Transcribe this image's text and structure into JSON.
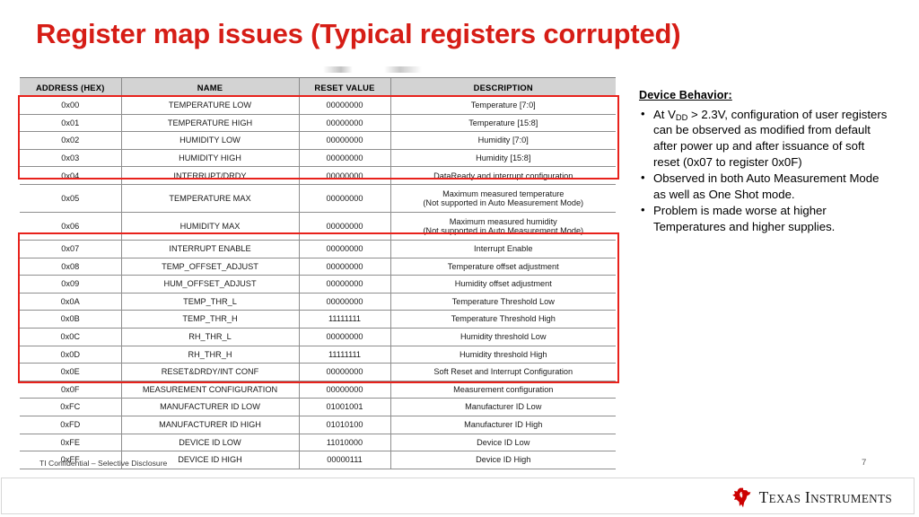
{
  "slide": {
    "title": "Register map issues (Typical registers corrupted)",
    "page_number": "7",
    "confidential": "TI Confidential – Selective Disclosure",
    "accent_red": "#e8221c",
    "title_red": "#d61d16",
    "header_gray": "#d3d3d3"
  },
  "table": {
    "columns": [
      "ADDRESS (HEX)",
      "NAME",
      "RESET VALUE",
      "DESCRIPTION"
    ],
    "rows": [
      {
        "address": "0x00",
        "name": "TEMPERATURE LOW",
        "reset": "00000000",
        "desc": "Temperature [7:0]",
        "desc2": ""
      },
      {
        "address": "0x01",
        "name": "TEMPERATURE HIGH",
        "reset": "00000000",
        "desc": "Temperature [15:8]",
        "desc2": ""
      },
      {
        "address": "0x02",
        "name": "HUMIDITY LOW",
        "reset": "00000000",
        "desc": "Humidity [7:0]",
        "desc2": ""
      },
      {
        "address": "0x03",
        "name": "HUMIDITY HIGH",
        "reset": "00000000",
        "desc": "Humidity [15:8]",
        "desc2": ""
      },
      {
        "address": "0x04",
        "name": "INTERRUPT/DRDY",
        "reset": "00000000",
        "desc": "DataReady and interrupt configuration",
        "desc2": ""
      },
      {
        "address": "0x05",
        "name": "TEMPERATURE MAX",
        "reset": "00000000",
        "desc": "Maximum measured temperature",
        "desc2": "(Not supported in Auto Measurement Mode)"
      },
      {
        "address": "0x06",
        "name": "HUMIDITY MAX",
        "reset": "00000000",
        "desc": "Maximum measured humidity",
        "desc2": "(Not supported in Auto Measurement Mode)"
      },
      {
        "address": "0x07",
        "name": "INTERRUPT ENABLE",
        "reset": "00000000",
        "desc": "Interrupt Enable",
        "desc2": ""
      },
      {
        "address": "0x08",
        "name": "TEMP_OFFSET_ADJUST",
        "reset": "00000000",
        "desc": "Temperature offset adjustment",
        "desc2": ""
      },
      {
        "address": "0x09",
        "name": "HUM_OFFSET_ADJUST",
        "reset": "00000000",
        "desc": "Humidity offset adjustment",
        "desc2": ""
      },
      {
        "address": "0x0A",
        "name": "TEMP_THR_L",
        "reset": "00000000",
        "desc": "Temperature Threshold Low",
        "desc2": ""
      },
      {
        "address": "0x0B",
        "name": "TEMP_THR_H",
        "reset": "11111111",
        "desc": "Temperature Threshold High",
        "desc2": ""
      },
      {
        "address": "0x0C",
        "name": "RH_THR_L",
        "reset": "00000000",
        "desc": "Humidity threshold Low",
        "desc2": ""
      },
      {
        "address": "0x0D",
        "name": "RH_THR_H",
        "reset": "11111111",
        "desc": "Humidity threshold High",
        "desc2": ""
      },
      {
        "address": "0x0E",
        "name": "RESET&DRDY/INT CONF",
        "reset": "00000000",
        "desc": "Soft Reset and Interrupt Configuration",
        "desc2": ""
      },
      {
        "address": "0x0F",
        "name": "MEASUREMENT CONFIGURATION",
        "reset": "00000000",
        "desc": "Measurement configuration",
        "desc2": ""
      },
      {
        "address": "0xFC",
        "name": "MANUFACTURER ID LOW",
        "reset": "01001001",
        "desc": "Manufacturer ID Low",
        "desc2": ""
      },
      {
        "address": "0xFD",
        "name": "MANUFACTURER ID HIGH",
        "reset": "01010100",
        "desc": "Manufacturer ID High",
        "desc2": ""
      },
      {
        "address": "0xFE",
        "name": "DEVICE ID LOW",
        "reset": "11010000",
        "desc": "Device ID Low",
        "desc2": ""
      },
      {
        "address": "0xFF",
        "name": "DEVICE ID HIGH",
        "reset": "00000111",
        "desc": "Device ID High",
        "desc2": ""
      }
    ],
    "highlight_boxes": [
      {
        "label": "registers 0x00-0x04 corrupted"
      },
      {
        "label": "registers 0x07-0x0F corrupted"
      }
    ]
  },
  "panel": {
    "heading": "Device Behavior:",
    "bullet_glyph": "•",
    "bullets": [
      {
        "pre": "At V",
        "sub": "DD",
        "post": " > 2.3V, configuration of user registers can be observed as modified from default after power up and after issuance of soft reset (0x07 to register 0x0F)"
      },
      {
        "pre": "",
        "sub": "",
        "post": "Observed in both Auto Measurement Mode as well as One Shot mode."
      },
      {
        "pre": "",
        "sub": "",
        "post": "Problem is made worse at higher Temperatures and higher supplies."
      }
    ]
  },
  "logo": {
    "word_first": "T",
    "word_first_rest": "EXAS",
    "word_second": "I",
    "word_second_rest": "NSTRUMENTS",
    "mark_color": "#cc0000"
  }
}
